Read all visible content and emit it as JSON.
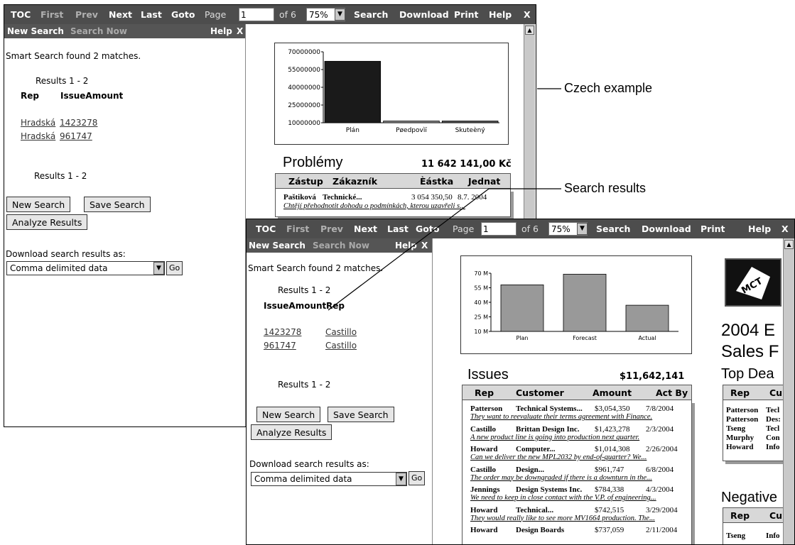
{
  "toolbar_back": {
    "toc": "TOC",
    "first": "First",
    "prev": "Prev",
    "next": "Next",
    "last": "Last",
    "goto": "Goto",
    "page_label": "Page",
    "page_value": "1",
    "of_pages": "of 6",
    "zoom": "75%",
    "search": "Search",
    "download": "Download",
    "print": "Print",
    "help": "Help",
    "close": "X"
  },
  "toolbar_front": {
    "toc": "TOC",
    "first": "First",
    "prev": "Prev",
    "next": "Next",
    "last": "Last",
    "goto": "Goto",
    "page_label": "Page",
    "page_value": "1",
    "of_pages": "of 6",
    "zoom": "75%",
    "search": "Search",
    "download": "Download",
    "print": "Print",
    "help": "Help",
    "close": "X"
  },
  "search_back": {
    "new_search": "New Search",
    "search_now": "Search Now",
    "help": "Help",
    "close": "X",
    "found": "Smart Search found 2 matches.",
    "results_range": "Results 1 - 2",
    "col_rep": "Rep",
    "col_amount": "IssueAmount",
    "rows": [
      {
        "rep": "Hradská",
        "amount": "1423278"
      },
      {
        "rep": "Hradská",
        "amount": "961747"
      }
    ],
    "results_range_bottom": "Results 1 - 2",
    "btn_new": "New Search",
    "btn_save": "Save Search",
    "btn_analyze": "Analyze Results",
    "download_label": "Download search results as:",
    "download_option": "Comma delimited data",
    "go": "Go"
  },
  "search_front": {
    "new_search": "New Search",
    "search_now": "Search Now",
    "help": "Help",
    "close": "X",
    "found": "Smart Search found 2 matches.",
    "results_range": "Results 1 - 2",
    "col_amount": "IssueAmount",
    "col_rep": "Rep",
    "rows": [
      {
        "amount": "1423278",
        "rep": "Castillo"
      },
      {
        "amount": "961747",
        "rep": "Castillo"
      }
    ],
    "results_range_bottom": "Results 1 - 2",
    "btn_new": "New Search",
    "btn_save": "Save Search",
    "btn_analyze": "Analyze Results",
    "download_label": "Download search results as:",
    "download_option": "Comma delimited data",
    "go": "Go"
  },
  "doc_back": {
    "section_title": "Problémy",
    "section_total": "11 642 141,00 Kč",
    "headers": [
      "Zástup",
      "Zákazník",
      "Èástka",
      "Jednat"
    ],
    "rows": [
      {
        "rep": "Paštiková",
        "customer": "Technické...",
        "amount": "3 054 350,50",
        "date": "8.7. 2004",
        "note": "Chtějí přehodnotit dohodu o podmínkách, kterou uzavřeli s..."
      }
    ]
  },
  "doc_front": {
    "section_title": "Issues",
    "section_total": "$11,642,141",
    "headers": [
      "Rep",
      "Customer",
      "Amount",
      "Act By"
    ],
    "rows": [
      {
        "rep": "Patterson",
        "customer": "Technical Systems...",
        "amount": "$3,054,350",
        "date": "7/8/2004",
        "note": "They want to reevaluate their terms agreement with Finance."
      },
      {
        "rep": "Castillo",
        "customer": "Brittan Design Inc.",
        "amount": "$1,423,278",
        "date": "2/3/2004",
        "note": "A new product line is going into production next quarter."
      },
      {
        "rep": "Howard",
        "customer": "Computer...",
        "amount": "$1,014,308",
        "date": "2/26/2004",
        "note": "Can we deliver the new MPL2032 by end-of-quarter? We..."
      },
      {
        "rep": "Castillo",
        "customer": "Design...",
        "amount": "$961,747",
        "date": "6/8/2004",
        "note": "The order may be downgraded if there is a downturn in the..."
      },
      {
        "rep": "Jennings",
        "customer": "Design Systems Inc.",
        "amount": "$784,338",
        "date": "4/3/2004",
        "note": "We need to keep in close contact with the V.P. of engineering..."
      },
      {
        "rep": "Howard",
        "customer": "Technical...",
        "amount": "$742,515",
        "date": "3/29/2004",
        "note": "They would really like to see more MV1664 production. The..."
      },
      {
        "rep": "Howard",
        "customer": "Design Boards",
        "amount": "$737,059",
        "date": "2/11/2004",
        "note": ""
      }
    ],
    "right_title_1": "2004 E",
    "right_title_2": "Sales F",
    "top_deals": "Top Dea",
    "top_headers": [
      "Rep",
      "Cu"
    ],
    "top_rows": [
      {
        "rep": "Patterson",
        "cu": "Tecl"
      },
      {
        "rep": "Patterson",
        "cu": "Des:"
      },
      {
        "rep": "Tseng",
        "cu": "Tecl"
      },
      {
        "rep": "Murphy",
        "cu": "Con"
      },
      {
        "rep": "Howard",
        "cu": "Info"
      }
    ],
    "negative": "Negative",
    "neg_headers": [
      "Rep",
      "Cu"
    ],
    "neg_rows": [
      {
        "rep": "Tseng",
        "cu": "Info"
      }
    ]
  },
  "chart_data": [
    {
      "type": "bar",
      "categories": [
        "Plán",
        "Pøedpovìï",
        "Skuteèný"
      ],
      "values": [
        62000000,
        11500000,
        11500000
      ],
      "colors": [
        "#1a1a1a",
        "#8c8c8c",
        "#595959"
      ],
      "yticks": [
        "70000000",
        "55000000",
        "40000000",
        "25000000",
        "10000000"
      ],
      "ylim": [
        10000000,
        70000000
      ]
    },
    {
      "type": "bar",
      "categories": [
        "Plan",
        "Forecast",
        "Actual"
      ],
      "values": [
        58,
        69,
        37
      ],
      "colors": [
        "#999999",
        "#999999",
        "#999999"
      ],
      "yticks": [
        "70 M",
        "55 M",
        "40 M",
        "25 M",
        "10 M"
      ],
      "ylim": [
        10,
        70
      ]
    }
  ],
  "callouts": {
    "czech": "Czech example",
    "search_results": "Search results"
  },
  "logo_text": "MCT",
  "colors": {
    "toolbar_bg": "#4d4d4d",
    "panel_header_bg": "#555555",
    "table_header_bg": "#d8d8d8"
  }
}
